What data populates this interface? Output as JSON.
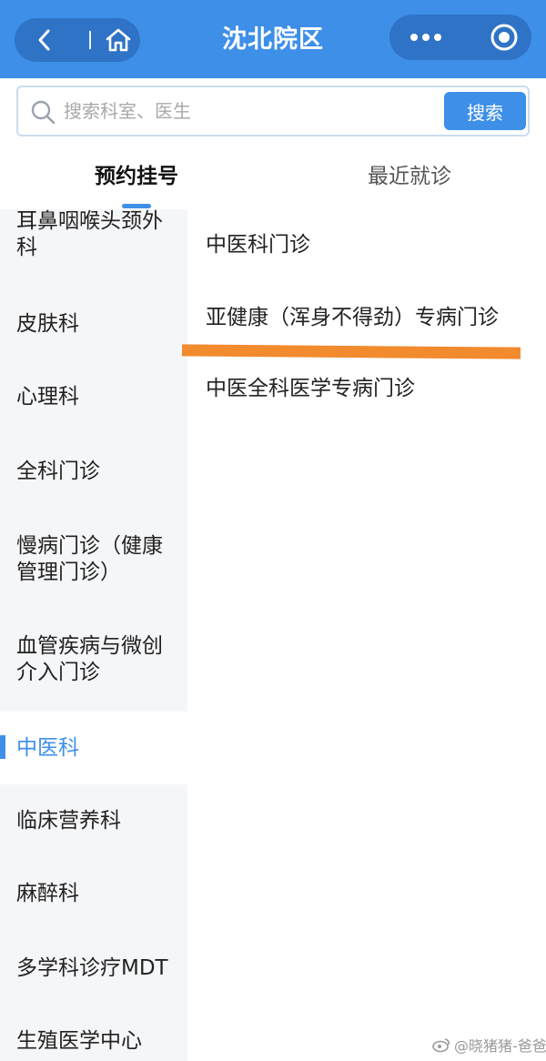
{
  "header": {
    "title": "沈北院区",
    "back_icon": "chevron-left-icon",
    "home_icon": "home-icon",
    "more_icon": "more-dots-icon",
    "close_icon": "close-circle-icon",
    "bg_color": "#3e8fe8"
  },
  "search": {
    "placeholder": "搜索科室、医生",
    "button_label": "搜索"
  },
  "tabs": [
    {
      "label": "预约挂号",
      "active": true
    },
    {
      "label": "最近就诊",
      "active": false
    }
  ],
  "sidebar": {
    "items": [
      {
        "label": "耳鼻咽喉头颈外科"
      },
      {
        "label": "皮肤科"
      },
      {
        "label": "心理科"
      },
      {
        "label": "全科门诊"
      },
      {
        "label": "慢病门诊（健康管理门诊）"
      },
      {
        "label": "血管疾病与微创介入门诊"
      },
      {
        "label": "中医科",
        "active": true
      },
      {
        "label": "临床营养科"
      },
      {
        "label": "麻醉科"
      },
      {
        "label": "多学科诊疗MDT"
      },
      {
        "label": "生殖医学中心"
      }
    ]
  },
  "clinics": [
    {
      "label": "中医科门诊"
    },
    {
      "label": "亚健康（浑身不得劲）专病门诊"
    },
    {
      "label": "中医全科医学专病门诊"
    }
  ],
  "watermark": "@晓猪猪-爸爸",
  "colors": {
    "accent": "#3e8fe8",
    "highlight_underline": "#f28a2e"
  }
}
